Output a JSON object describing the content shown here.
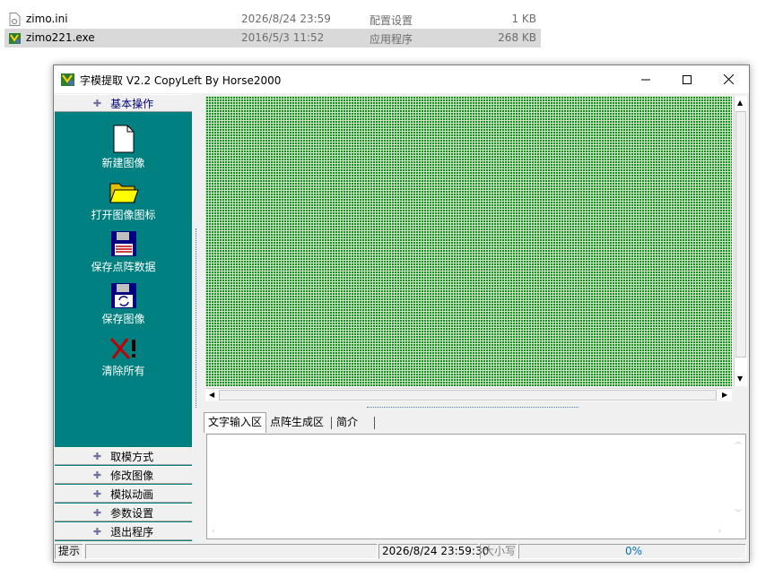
{
  "explorer": {
    "files": [
      {
        "name": "zimo.ini",
        "date": "2026/8/24 23:59",
        "type": "配置设置",
        "size": "1 KB",
        "icon": "ini-file-icon"
      },
      {
        "name": "zimo221.exe",
        "date": "2016/5/3 11:52",
        "type": "应用程序",
        "size": "268 KB",
        "icon": "exe-app-icon"
      }
    ]
  },
  "window": {
    "title": "字模提取 V2.2  CopyLeft By Horse2000",
    "controls": {
      "minimize": "minimize-icon",
      "maximize": "maximize-icon",
      "close": "close-icon"
    }
  },
  "sidebar": {
    "active_group": "基本操作",
    "tools": [
      {
        "label": "新建图像",
        "icon": "new-page-icon"
      },
      {
        "label": "打开图像图标",
        "icon": "folder-open-icon"
      },
      {
        "label": "保存点阵数据",
        "icon": "save-data-disk-icon"
      },
      {
        "label": "保存图像",
        "icon": "save-image-disk-icon"
      },
      {
        "label": "清除所有",
        "icon": "clear-all-icon"
      }
    ],
    "groups": [
      "取模方式",
      "修改图像",
      "模拟动画",
      "参数设置",
      "退出程序"
    ]
  },
  "canvas": {
    "grid_color": "#1e8c1e",
    "grid_line_color": "#c8e6c8"
  },
  "tabs": [
    "文字输入区",
    "点阵生成区",
    "简介"
  ],
  "text_input": {
    "value": ""
  },
  "statusbar": {
    "hint": "提示",
    "message": "",
    "datetime": "2026/8/24 23:59:30",
    "caps": "大小写",
    "progress": "0%"
  },
  "colors": {
    "panel": "#008080",
    "selected_row": "#d9d9d9",
    "accent_text": "#000080"
  }
}
